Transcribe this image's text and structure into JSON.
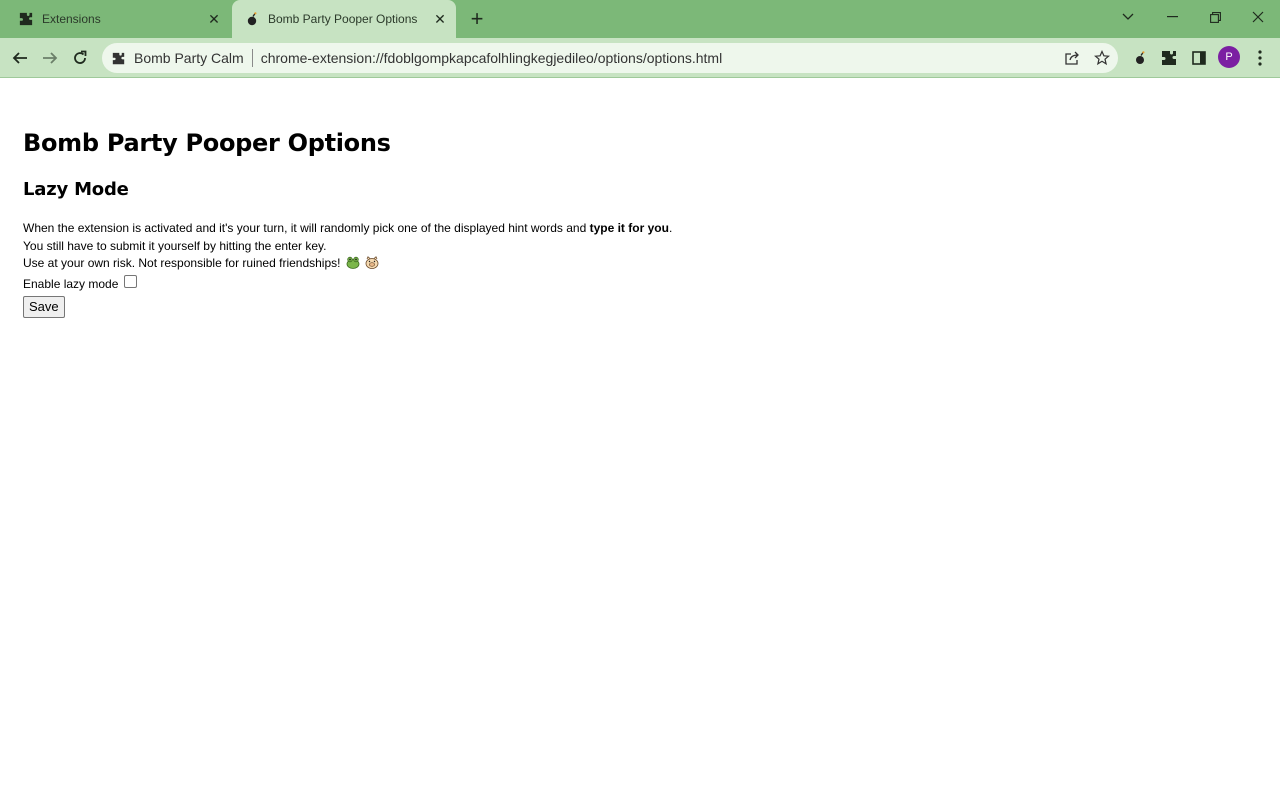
{
  "browser": {
    "tabs": [
      {
        "label": "Extensions",
        "icon": "puzzle-icon",
        "active": false
      },
      {
        "label": "Bomb Party Pooper Options",
        "icon": "bomb-icon",
        "active": true
      }
    ],
    "new_tab": "+",
    "address_bar": {
      "site_label": "Bomb Party Calm",
      "url": "chrome-extension://fdoblgompkapcafolhlingkegjedileo/options/options.html"
    },
    "profile_initial": "P",
    "colors": {
      "tabstrip": "#7cb878",
      "toolbar": "#c7e3c2",
      "avatar": "#7b1fa2"
    }
  },
  "page": {
    "title": "Bomb Party Pooper Options",
    "section_title": "Lazy Mode",
    "desc_line1_prefix": "When the extension is activated and it's your turn, it will randomly pick one of the displayed hint words and ",
    "desc_line1_bold": "type it for you",
    "desc_line1_suffix": ".",
    "desc_line2": "You still have to submit it yourself by hitting the enter key.",
    "desc_line3": "Use at your own risk. Not responsible for ruined friendships!",
    "emojis": [
      "frog-emoji",
      "pig-face-emoji"
    ],
    "option_label": "Enable lazy mode",
    "option_checked": false,
    "save_label": "Save"
  }
}
